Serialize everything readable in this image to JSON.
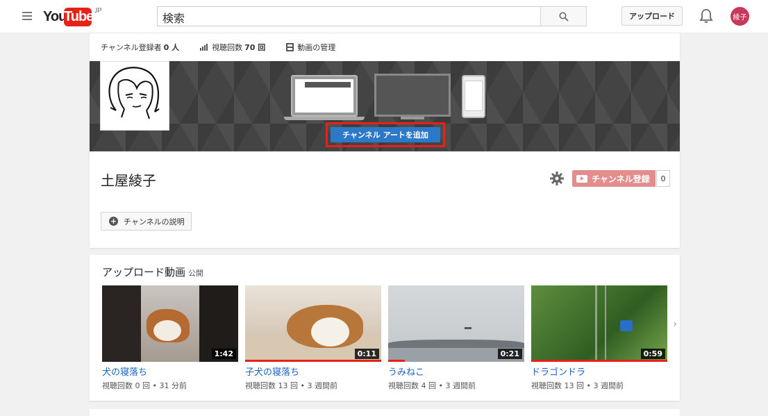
{
  "header": {
    "logo_you": "You",
    "logo_tube": "Tube",
    "logo_region": "JP",
    "search_placeholder": "検索",
    "upload_label": "アップロード",
    "avatar_text": "綾子"
  },
  "channel": {
    "subscribers_label": "チャンネル登録者",
    "subscribers_value": "0 人",
    "views_label": "視聴回数",
    "views_value": "70 回",
    "manage_label": "動画の管理",
    "add_art_label": "チャンネル アートを追加",
    "name": "土屋綾子",
    "subscribe_label": "チャンネル登録",
    "subscribe_count": "0",
    "description_label": "チャンネルの説明"
  },
  "uploads": {
    "title": "アップロード動画",
    "visibility": "公開",
    "videos": [
      {
        "title": "犬の寝落ち",
        "meta": "視聴回数 0 回 • 31 分前",
        "duration": "1:42",
        "progress": 0
      },
      {
        "title": "子犬の寝落ち",
        "meta": "視聴回数 13 回 • 3 週間前",
        "duration": "0:11",
        "progress": 1
      },
      {
        "title": "うみねこ",
        "meta": "視聴回数 4 回 • 3 週間前",
        "duration": "0:21",
        "progress": 0.12
      },
      {
        "title": "ドラゴンドラ",
        "meta": "視聴回数 13 回 • 3 週間前",
        "duration": "0:59",
        "progress": 1
      }
    ]
  },
  "colors": {
    "accent_red": "#e62117",
    "button_blue": "#2c78c9",
    "link_blue": "#1b62be"
  }
}
